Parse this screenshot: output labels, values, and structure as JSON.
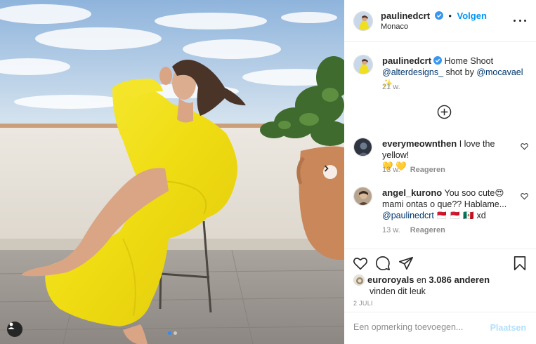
{
  "post": {
    "username": "paulinedcrt",
    "verified": true,
    "separator": "•",
    "follow_label": "Volgen",
    "location": "Monaco",
    "more_icon": "ellipsis-horizontal-icon",
    "carousel": {
      "slide_count": 2,
      "current_slide": 1
    }
  },
  "caption": {
    "username": "paulinedcrt",
    "text_prefix": "Home Shoot",
    "mention_1": "@alterdesigns_",
    "text_mid": "shot by",
    "mention_2": "@mocavael",
    "sparkle": "✨",
    "time": "21 w."
  },
  "load_more_icon": "plus-circle-icon",
  "comments": [
    {
      "username": "everymeownthen",
      "text": "I love the yellow!",
      "emoji": "💛 💛",
      "time": "13 w.",
      "reply_label": "Reageren"
    },
    {
      "username": "angel_kurono",
      "text_1": "You soo cute😍",
      "text_2": "mami ontas o que?? Hablame...",
      "mention": "@paulinedcrt",
      "flags": "🇲🇨 🇲🇨 🇲🇽",
      "text_3": "xd",
      "time": "13 w.",
      "reply_label": "Reageren"
    }
  ],
  "likes": {
    "user": "euroroyals",
    "and_text": "en",
    "count_text": "3.086 anderen",
    "line2": "vinden dit leuk"
  },
  "date": "2 JULI",
  "add_comment": {
    "placeholder": "Een opmerking toevoegen...",
    "post_label": "Plaatsen"
  },
  "colors": {
    "accent": "#0095f6",
    "link": "#00376b",
    "muted": "#8e8e8e",
    "dress_yellow": "#f2e21c"
  }
}
